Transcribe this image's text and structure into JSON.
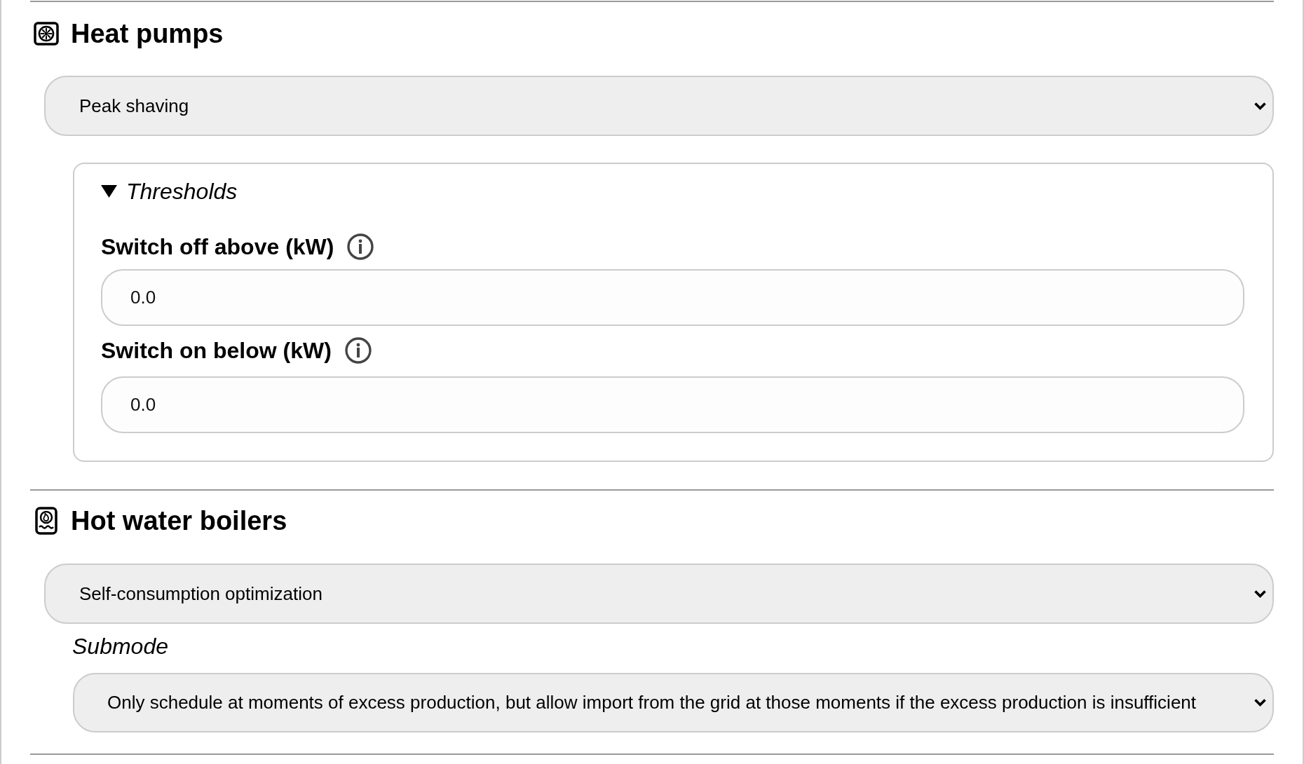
{
  "sections": [
    {
      "kind": "heat_pump",
      "title": "Heat pumps",
      "mode": {
        "value": "Peak shaving"
      },
      "thresholds": {
        "summary": "Thresholds",
        "expanded": true,
        "fields": [
          {
            "label": "Switch off above (kW)",
            "value": "0.0"
          },
          {
            "label": "Switch on below (kW)",
            "value": "0.0"
          }
        ]
      }
    },
    {
      "kind": "boiler",
      "title": "Hot water boilers",
      "mode": {
        "value": "Self-consumption optimization"
      },
      "submode": {
        "label": "Submode",
        "value": "Only schedule at moments of excess production, but allow import from the grid at those moments if the excess production is insufficient"
      }
    }
  ]
}
